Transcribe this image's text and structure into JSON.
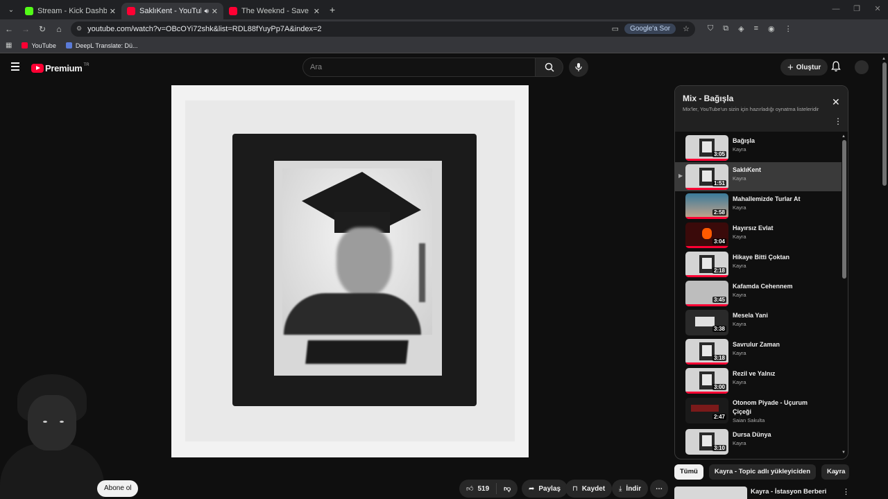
{
  "browser": {
    "tabs": [
      {
        "title": "Stream - Kick Dashboard",
        "active": false,
        "favicon": "kick-icon"
      },
      {
        "title": "SaklıKent - YouTube",
        "active": true,
        "favicon": "youtube-icon"
      },
      {
        "title": "The Weeknd - Save Your Tears (",
        "active": false,
        "favicon": "youtube-icon"
      }
    ],
    "url": "youtube.com/watch?v=OBcOYi72shk&list=RDL88fYuyPp7A&index=2",
    "google_sor": "Google'a Sor",
    "bookmarks": [
      {
        "label": "YouTube",
        "color": "#ff0033"
      },
      {
        "label": "DeepL Translate: Dü...",
        "color": "#0f2b46"
      }
    ]
  },
  "header": {
    "logo_word": "Premium",
    "country_code": "TR",
    "search_placeholder": "Ara",
    "create_label": "Oluştur"
  },
  "actions": {
    "subscribe": "Abone ol",
    "like_count": "519",
    "share": "Paylaş",
    "save": "Kaydet",
    "download": "İndir"
  },
  "playlist": {
    "title": "Mix - Bağışla",
    "subtitle": "Mix'ler, YouTube'un sizin için hazırladığı oynatma listeleridir",
    "items": [
      {
        "title": "Bağışla",
        "artist": "Kayra",
        "duration": "3:05",
        "current": false
      },
      {
        "title": "SaklıKent",
        "artist": "Kayra",
        "duration": "1:51",
        "current": true
      },
      {
        "title": "Mahallemizde Turlar At",
        "artist": "Kayra",
        "duration": "2:58",
        "current": false
      },
      {
        "title": "Hayırsız Evlat",
        "artist": "Kayra",
        "duration": "3:04",
        "current": false
      },
      {
        "title": "Hikaye Bitti Çoktan",
        "artist": "Kayra",
        "duration": "2:18",
        "current": false
      },
      {
        "title": "Kafamda Cehennem",
        "artist": "Kayra",
        "duration": "3:45",
        "current": false
      },
      {
        "title": "Mesela Yani",
        "artist": "Kayra",
        "duration": "3:38",
        "current": false
      },
      {
        "title": "Savrulur Zaman",
        "artist": "Kayra",
        "duration": "3:18",
        "current": false
      },
      {
        "title": "Rezil ve Yalnız",
        "artist": "Kayra",
        "duration": "3:00",
        "current": false
      },
      {
        "title": "Otonom Piyade - Uçurum Çiçeği",
        "artist": "Saian Sakulta",
        "duration": "2:47",
        "current": false
      },
      {
        "title": "Dursa Dünya",
        "artist": "Kayra",
        "duration": "3:10",
        "current": false
      }
    ]
  },
  "chips": [
    "Tümü",
    "Kayra - Topic adlı yükleyiciden",
    "Kayra"
  ],
  "recommended": {
    "title": "Kayra - İstasyon Berberi"
  }
}
